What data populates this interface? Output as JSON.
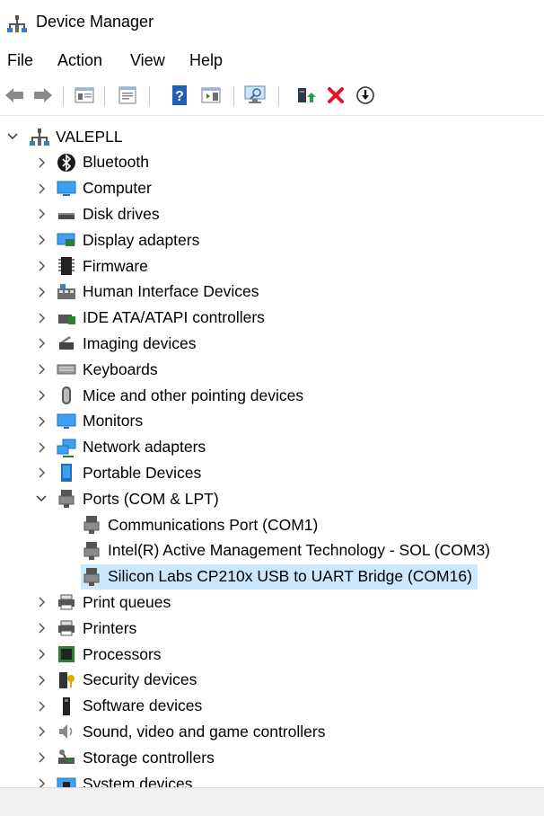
{
  "window": {
    "title": "Device Manager"
  },
  "menu": {
    "items": [
      "File",
      "Action",
      "View",
      "Help"
    ]
  },
  "toolbar": {
    "buttons": [
      "back",
      "forward",
      "show-hide-tree",
      "properties",
      "help",
      "action-pane",
      "scan-hardware",
      "update-driver",
      "uninstall",
      "disable"
    ]
  },
  "tree": {
    "root": "VALEPLL",
    "categories": [
      {
        "label": "Bluetooth",
        "icon": "bluetooth-icon",
        "expanded": false
      },
      {
        "label": "Computer",
        "icon": "computer-icon",
        "expanded": false
      },
      {
        "label": "Disk drives",
        "icon": "disk-drive-icon",
        "expanded": false
      },
      {
        "label": "Display adapters",
        "icon": "display-adapter-icon",
        "expanded": false
      },
      {
        "label": "Firmware",
        "icon": "firmware-icon",
        "expanded": false
      },
      {
        "label": "Human Interface Devices",
        "icon": "hid-icon",
        "expanded": false
      },
      {
        "label": "IDE ATA/ATAPI controllers",
        "icon": "ide-controller-icon",
        "expanded": false
      },
      {
        "label": "Imaging devices",
        "icon": "imaging-icon",
        "expanded": false
      },
      {
        "label": "Keyboards",
        "icon": "keyboard-icon",
        "expanded": false
      },
      {
        "label": "Mice and other pointing devices",
        "icon": "mouse-icon",
        "expanded": false
      },
      {
        "label": "Monitors",
        "icon": "monitor-icon",
        "expanded": false
      },
      {
        "label": "Network adapters",
        "icon": "network-adapter-icon",
        "expanded": false
      },
      {
        "label": "Portable Devices",
        "icon": "portable-device-icon",
        "expanded": false
      },
      {
        "label": "Ports (COM & LPT)",
        "icon": "port-icon",
        "expanded": true,
        "children": [
          {
            "label": "Communications Port (COM1)",
            "icon": "port-icon",
            "selected": false
          },
          {
            "label": "Intel(R) Active Management Technology - SOL (COM3)",
            "icon": "port-icon",
            "selected": false
          },
          {
            "label": "Silicon Labs CP210x USB to UART Bridge (COM16)",
            "icon": "port-icon",
            "selected": true
          }
        ]
      },
      {
        "label": "Print queues",
        "icon": "printer-icon",
        "expanded": false
      },
      {
        "label": "Printers",
        "icon": "printer-icon",
        "expanded": false
      },
      {
        "label": "Processors",
        "icon": "processor-icon",
        "expanded": false
      },
      {
        "label": "Security devices",
        "icon": "security-device-icon",
        "expanded": false
      },
      {
        "label": "Software devices",
        "icon": "software-device-icon",
        "expanded": false
      },
      {
        "label": "Sound, video and game controllers",
        "icon": "sound-icon",
        "expanded": false
      },
      {
        "label": "Storage controllers",
        "icon": "storage-controller-icon",
        "expanded": false
      },
      {
        "label": "System devices",
        "icon": "system-device-icon",
        "expanded": false
      }
    ]
  },
  "colors": {
    "selection": "#cce8ff",
    "accent": "#0078d7",
    "uninstall_red": "#e81123"
  }
}
